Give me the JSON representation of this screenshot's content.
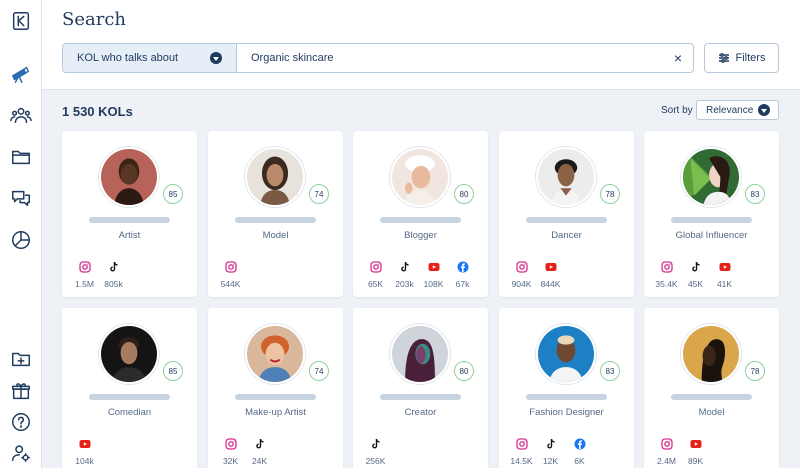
{
  "header": {
    "title": "Search",
    "search_type": "KOL who talks about",
    "search_value": "Organic skincare",
    "clear_label": "×",
    "filters_label": "Filters"
  },
  "results": {
    "count_label": "1 530 KOLs",
    "sort_label": "Sort by",
    "sort_value": "Relevance"
  },
  "sidebar": {
    "items": [
      "logo-icon",
      "telescope-icon",
      "users-icon",
      "folder-icon",
      "chat-icon",
      "pie-chart-icon",
      "folder-add-icon",
      "gift-icon",
      "help-icon",
      "user-settings-icon"
    ]
  },
  "colors": {
    "accent": "#1f3a5f",
    "score_ring": "#8fd19e",
    "instagram": "#d62f8c",
    "youtube": "#e62117",
    "facebook": "#1877f2",
    "tiktok": "#111111"
  },
  "kols": [
    {
      "role": "Artist",
      "score": "85",
      "socials": [
        {
          "net": "instagram",
          "value": "1.5M"
        },
        {
          "net": "tiktok",
          "value": "805k"
        }
      ]
    },
    {
      "role": "Model",
      "score": "74",
      "socials": [
        {
          "net": "instagram",
          "value": "544K"
        }
      ]
    },
    {
      "role": "Blogger",
      "score": "80",
      "socials": [
        {
          "net": "instagram",
          "value": "65K"
        },
        {
          "net": "tiktok",
          "value": "203k"
        },
        {
          "net": "youtube",
          "value": "108K"
        },
        {
          "net": "facebook",
          "value": "67k"
        }
      ]
    },
    {
      "role": "Dancer",
      "score": "78",
      "socials": [
        {
          "net": "instagram",
          "value": "904K"
        },
        {
          "net": "youtube",
          "value": "844K"
        }
      ]
    },
    {
      "role": "Global Influencer",
      "score": "83",
      "socials": [
        {
          "net": "instagram",
          "value": "35.4K"
        },
        {
          "net": "tiktok",
          "value": "45K"
        },
        {
          "net": "youtube",
          "value": "41K"
        }
      ]
    },
    {
      "role": "Comedian",
      "score": "85",
      "socials": [
        {
          "net": "youtube",
          "value": "104k"
        }
      ]
    },
    {
      "role": "Make-up Artist",
      "score": "74",
      "socials": [
        {
          "net": "instagram",
          "value": "32K"
        },
        {
          "net": "tiktok",
          "value": "24K"
        }
      ]
    },
    {
      "role": "Creator",
      "score": "80",
      "socials": [
        {
          "net": "tiktok",
          "value": "256K"
        }
      ]
    },
    {
      "role": "Fashion Designer",
      "score": "83",
      "socials": [
        {
          "net": "instagram",
          "value": "14.5K"
        },
        {
          "net": "tiktok",
          "value": "12K"
        },
        {
          "net": "facebook",
          "value": "6K"
        }
      ]
    },
    {
      "role": "Model",
      "score": "78",
      "socials": [
        {
          "net": "instagram",
          "value": "2.4M"
        },
        {
          "net": "youtube",
          "value": "89K"
        }
      ]
    }
  ]
}
